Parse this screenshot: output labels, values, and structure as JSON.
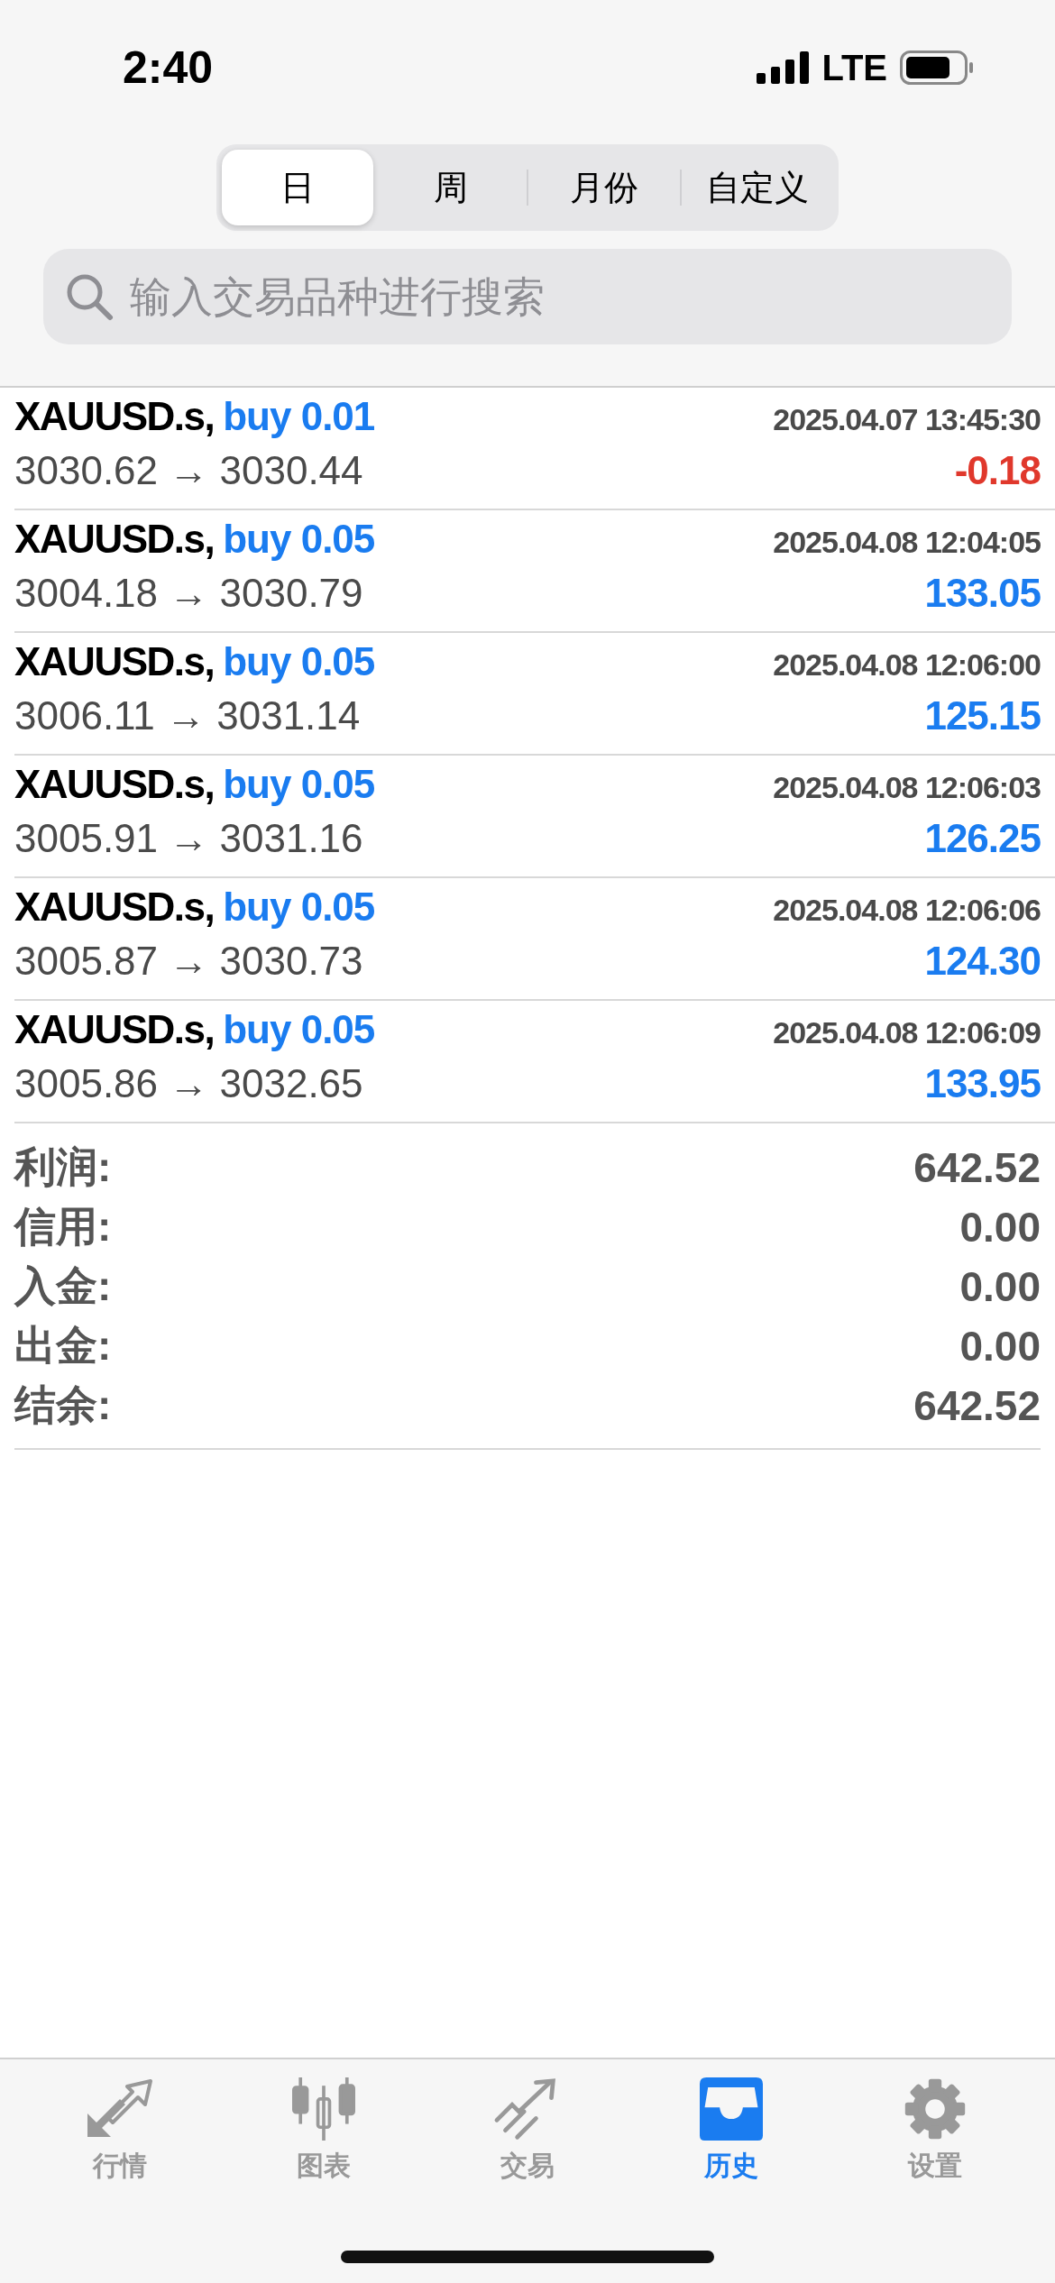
{
  "status_bar": {
    "time": "2:40",
    "network": "LTE"
  },
  "period_tabs": [
    {
      "label": "日",
      "selected": true
    },
    {
      "label": "周",
      "selected": false
    },
    {
      "label": "月份",
      "selected": false
    },
    {
      "label": "自定义",
      "selected": false
    }
  ],
  "search": {
    "placeholder": "输入交易品种进行搜索"
  },
  "trades": [
    {
      "symbol": "XAUUSD.s,",
      "order": "buy 0.01",
      "time": "2025.04.07 13:45:30",
      "prices": "3030.62 → 3030.44",
      "profit": "-0.18",
      "color": "#e0382c"
    },
    {
      "symbol": "XAUUSD.s,",
      "order": "buy 0.05",
      "time": "2025.04.08 12:04:05",
      "prices": "3004.18 → 3030.79",
      "profit": "133.05",
      "color": "#1a7cf0"
    },
    {
      "symbol": "XAUUSD.s,",
      "order": "buy 0.05",
      "time": "2025.04.08 12:06:00",
      "prices": "3006.11 → 3031.14",
      "profit": "125.15",
      "color": "#1a7cf0"
    },
    {
      "symbol": "XAUUSD.s,",
      "order": "buy 0.05",
      "time": "2025.04.08 12:06:03",
      "prices": "3005.91 → 3031.16",
      "profit": "126.25",
      "color": "#1a7cf0"
    },
    {
      "symbol": "XAUUSD.s,",
      "order": "buy 0.05",
      "time": "2025.04.08 12:06:06",
      "prices": "3005.87 → 3030.73",
      "profit": "124.30",
      "color": "#1a7cf0"
    },
    {
      "symbol": "XAUUSD.s,",
      "order": "buy 0.05",
      "time": "2025.04.08 12:06:09",
      "prices": "3005.86 → 3032.65",
      "profit": "133.95",
      "color": "#1a7cf0"
    }
  ],
  "summary": [
    {
      "label": "利润:",
      "value": "642.52"
    },
    {
      "label": "信用:",
      "value": "0.00"
    },
    {
      "label": "入金:",
      "value": "0.00"
    },
    {
      "label": "出金:",
      "value": "0.00"
    },
    {
      "label": "结余:",
      "value": "642.52"
    }
  ],
  "bottom_tabs": [
    {
      "label": "行情",
      "selected": false
    },
    {
      "label": "图表",
      "selected": false
    },
    {
      "label": "交易",
      "selected": false
    },
    {
      "label": "历史",
      "selected": true
    },
    {
      "label": "设置",
      "selected": false
    }
  ]
}
